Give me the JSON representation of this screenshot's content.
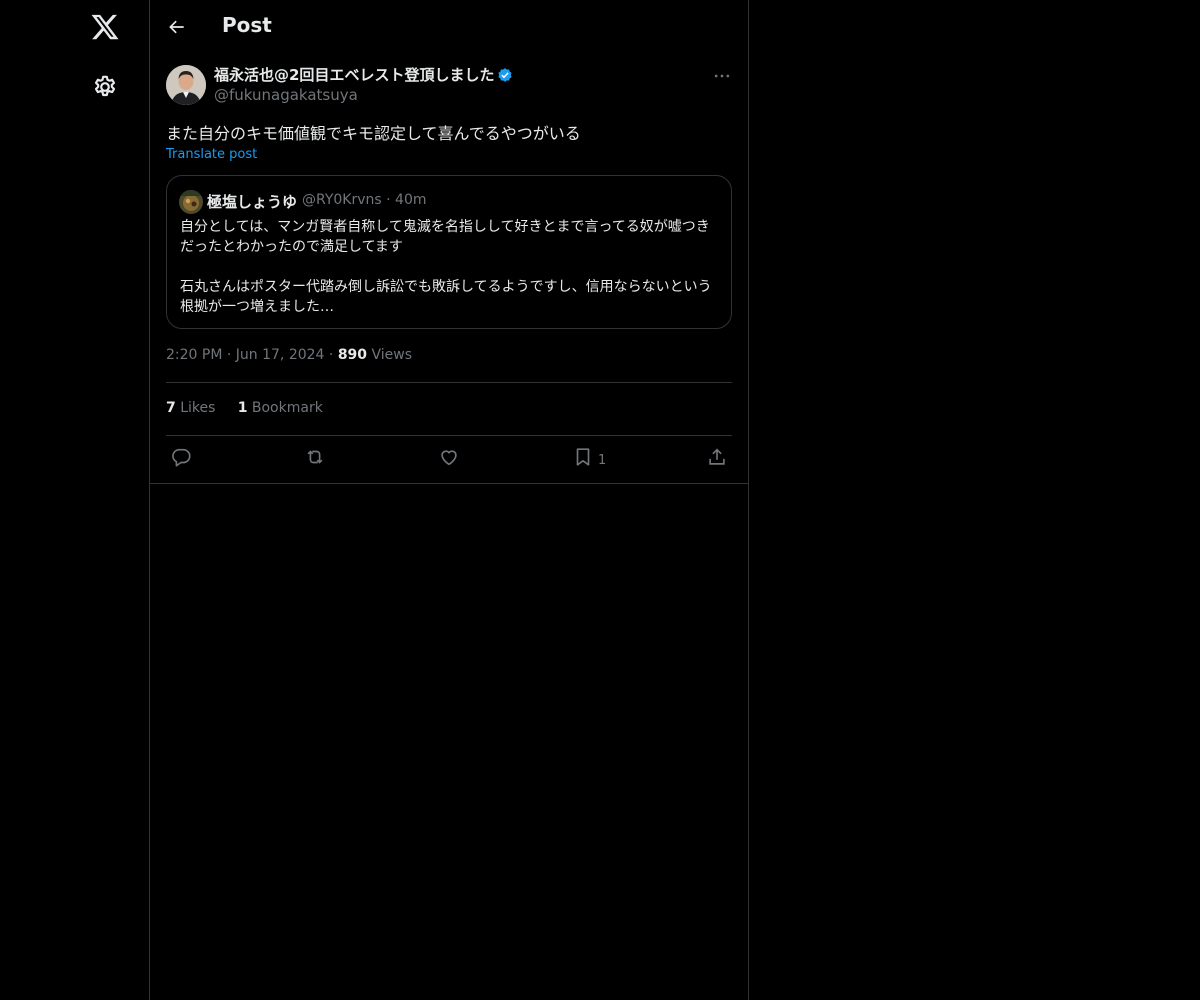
{
  "header": {
    "title": "Post"
  },
  "post": {
    "author_name": "福永活也@2回目エベレスト登頂しました",
    "author_handle": "@fukunagakatsuya",
    "text": "また自分のキモ価値観でキモ認定して喜んでるやつがいる",
    "translate_label": "Translate post",
    "time": "2:20 PM",
    "date": "Jun 17, 2024",
    "views_count": "890",
    "views_label": "Views",
    "likes_count": "7",
    "likes_label": "Likes",
    "bookmarks_count": "1",
    "bookmarks_label": "Bookmark",
    "action_bookmark_count": "1"
  },
  "quote": {
    "author_name": "極塩しょうゆ",
    "author_handle": "@RY0Krvns",
    "age": "40m",
    "para1": "自分としては、マンガ賢者自称して鬼滅を名指しして好きとまで言ってる奴が嘘つきだったとわかったので満足してます",
    "para2": "石丸さんはポスター代踏み倒し訴訟でも敗訴してるようですし、信用ならないという根拠が一つ増えました…"
  },
  "colors": {
    "accent": "#1d9bf0",
    "muted": "#71767b",
    "border": "#2f3336",
    "background": "#000000"
  },
  "icons": {
    "logo": "x-logo-icon",
    "settings": "gear-icon",
    "back": "back-arrow-icon",
    "more": "more-icon",
    "verified": "verified-badge-icon",
    "reply": "reply-icon",
    "repost": "repost-icon",
    "like": "heart-icon",
    "bookmark": "bookmark-icon",
    "share": "share-icon"
  }
}
